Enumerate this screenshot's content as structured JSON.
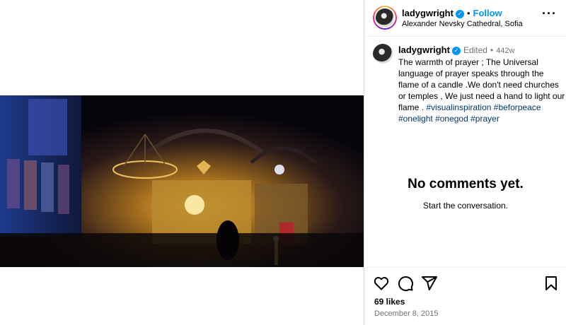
{
  "post": {
    "username": "ladygwright",
    "follow_label": "Follow",
    "location": "Alexander Nevsky Cathedral, Sofia",
    "edited_label": "Edited",
    "age": "442w",
    "caption_text": "The warmth of prayer ; The Universal language of prayer speaks through the flame of a candle .We don't need churches or temples , We just need a hand to light our flame .",
    "hashtags": [
      "#visualinspiration",
      "#beforpeace",
      "#onelight",
      "#onegod",
      "#prayer"
    ],
    "likes": "69 likes",
    "date": "December 8, 2015"
  },
  "comments": {
    "empty_title": "No comments yet.",
    "empty_subtitle": "Start the conversation."
  },
  "icons": [
    "verified-icon",
    "more-options-icon",
    "heart-icon",
    "comment-icon",
    "share-icon",
    "bookmark-icon"
  ],
  "colors": {
    "accent": "#0095f6",
    "hashtag": "#00376b",
    "muted": "#737373"
  }
}
